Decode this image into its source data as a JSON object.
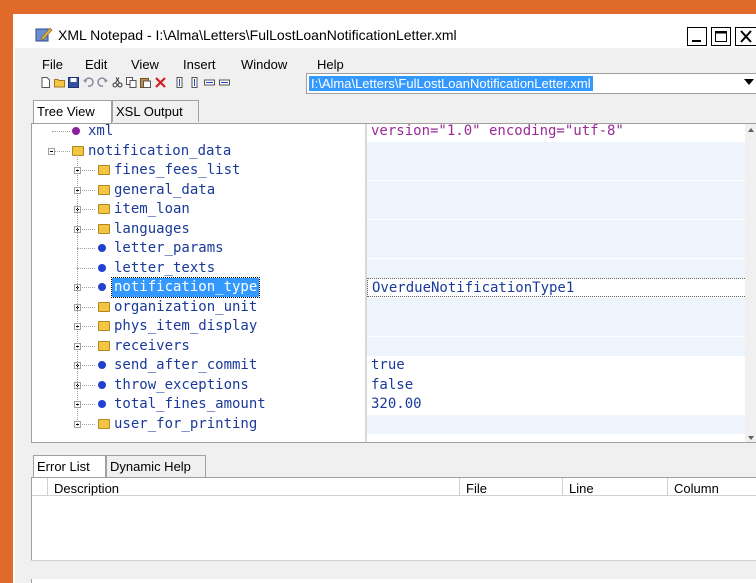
{
  "window": {
    "title": "XML Notepad - I:\\Alma\\Letters\\FulLostLoanNotificationLetter.xml",
    "minimize_label": "_",
    "maximize_label": "☐",
    "close_label": "✕"
  },
  "menu": {
    "items": [
      "File",
      "Edit",
      "View",
      "Insert",
      "Window",
      "Help"
    ]
  },
  "toolbar": {
    "path": "I:\\Alma\\Letters\\FulLostLoanNotificationLetter.xml"
  },
  "tabs": {
    "tree_view": "Tree View",
    "xsl_output": "XSL Output"
  },
  "tree": {
    "nodes": [
      {
        "label": "xml",
        "kind": "pi",
        "value": "version=\"1.0\" encoding=\"utf-8\""
      },
      {
        "label": "notification_data",
        "kind": "folder-open",
        "value": ""
      },
      {
        "label": "fines_fees_list",
        "kind": "folder",
        "value": ""
      },
      {
        "label": "general_data",
        "kind": "folder",
        "value": ""
      },
      {
        "label": "item_loan",
        "kind": "folder",
        "value": ""
      },
      {
        "label": "languages",
        "kind": "folder",
        "value": ""
      },
      {
        "label": "letter_params",
        "kind": "leaf",
        "value": ""
      },
      {
        "label": "letter_texts",
        "kind": "leaf",
        "value": ""
      },
      {
        "label": "notification_type",
        "kind": "leaf-exp",
        "value": "OverdueNotificationType1"
      },
      {
        "label": "organization_unit",
        "kind": "folder",
        "value": ""
      },
      {
        "label": "phys_item_display",
        "kind": "folder",
        "value": ""
      },
      {
        "label": "receivers",
        "kind": "folder",
        "value": ""
      },
      {
        "label": "send_after_commit",
        "kind": "leaf-exp",
        "value": "true"
      },
      {
        "label": "throw_exceptions",
        "kind": "leaf-exp",
        "value": "false"
      },
      {
        "label": "total_fines_amount",
        "kind": "leaf-exp",
        "value": "320.00"
      },
      {
        "label": "user_for_printing",
        "kind": "folder",
        "value": ""
      }
    ]
  },
  "bottom_tabs": {
    "error_list": "Error List",
    "dynamic_help": "Dynamic Help"
  },
  "error_list": {
    "columns": [
      "Description",
      "File",
      "Line",
      "Column"
    ]
  },
  "colors": {
    "desktop": "#e06a2a",
    "selection": "#3399ff",
    "node_text": "#1a3a9a",
    "pi_text": "#9a2a9a"
  }
}
